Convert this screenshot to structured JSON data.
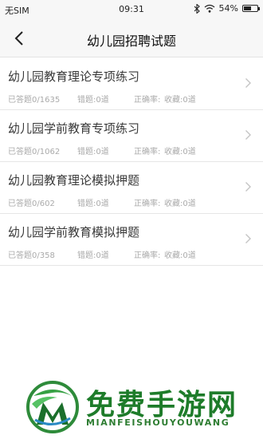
{
  "status_bar": {
    "carrier": "无SIM",
    "time": "09:31",
    "battery": "54%",
    "battery_level": 0.54
  },
  "nav": {
    "title": "幼儿园招聘试题"
  },
  "items": [
    {
      "name": "幼儿园教育理论专项练习",
      "answered": "已答题0/1635",
      "wrong": "错题:0道",
      "accuracy": "正确率:",
      "collected": "收藏:0道"
    },
    {
      "name": "幼儿园学前教育专项练习",
      "answered": "已答题0/1062",
      "wrong": "错题:0道",
      "accuracy": "正确率:",
      "collected": "收藏:0道"
    },
    {
      "name": "幼儿园教育理论模拟押题",
      "answered": "已答题0/602",
      "wrong": "错题:0道",
      "accuracy": "正确率:",
      "collected": "收藏:0道"
    },
    {
      "name": "幼儿园学前教育模拟押题",
      "answered": "已答题0/358",
      "wrong": "错题:0道",
      "accuracy": "正确率:",
      "collected": "收藏:0道"
    }
  ],
  "watermark": {
    "title": "免费手游网",
    "subtitle": "MIANFEISHOUYOUWANG",
    "color": "#1e7c2a"
  }
}
